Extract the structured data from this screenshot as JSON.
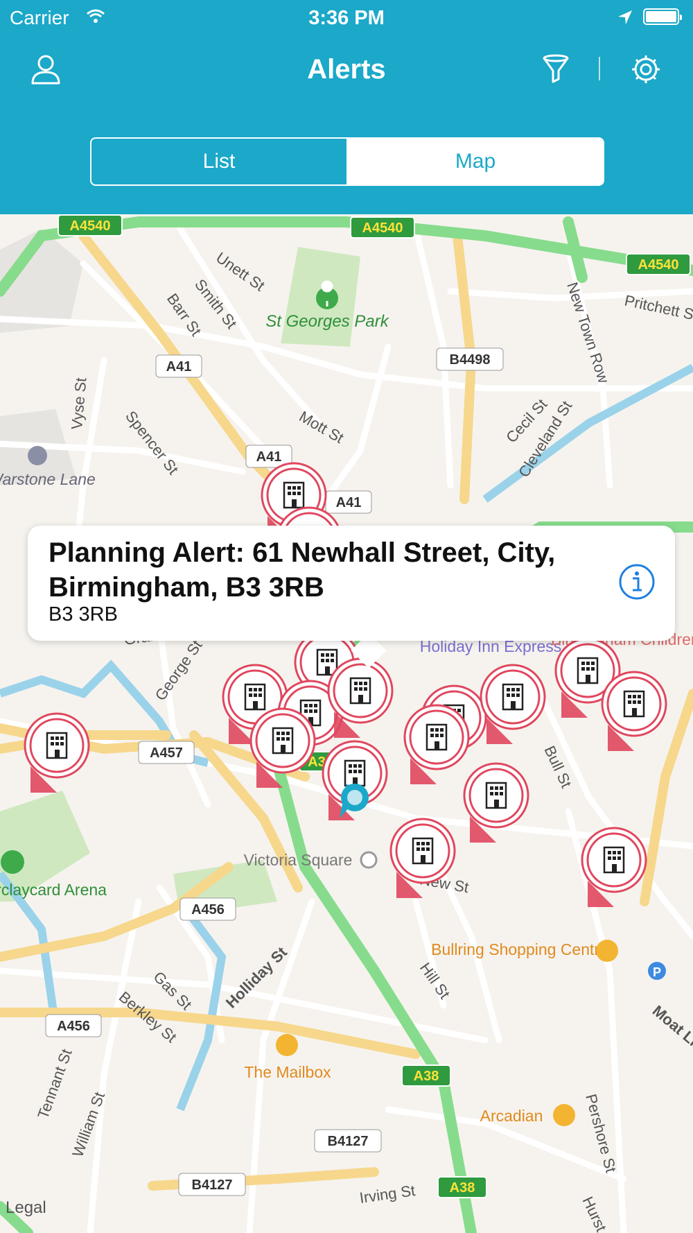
{
  "status_bar": {
    "carrier": "Carrier",
    "time": "3:36 PM"
  },
  "nav": {
    "title": "Alerts"
  },
  "segments": {
    "list_label": "List",
    "map_label": "Map",
    "selected": "Map"
  },
  "map": {
    "road_labels": [
      "A4540",
      "A4540",
      "A4540",
      "A41",
      "A41",
      "A41",
      "B4498",
      "A457",
      "A456",
      "A456",
      "A38",
      "A38",
      "B4127",
      "B4127",
      "A3"
    ],
    "street_labels": [
      "Unett St",
      "Smith St",
      "Barr St",
      "Pritchett St",
      "New Town Row",
      "Vyse St",
      "Spencer St",
      "Mott St",
      "Cecil St",
      "Cleveland St",
      "Graham St",
      "George St",
      "Bull St",
      "Holliday St",
      "Gas St",
      "Berkley St",
      "Hill St",
      "Tennant St",
      "William St",
      "Irving St",
      "Pershore St",
      "Hurst St",
      "Moat Ln",
      "New St"
    ],
    "place_labels": {
      "park": "St Georges Park",
      "warstone": "Warstone Lane",
      "holiday_inn": "Holiday Inn Express",
      "hospital": "Birmingham Children's Hospital",
      "victoria": "Victoria Square",
      "barclaycard": "Barclaycard Arena",
      "bullring": "Bullring Shopping Centre",
      "mailbox": "The Mailbox",
      "arcadian": "Arcadian"
    },
    "legal": "Legal",
    "pin_icon": "building-icon",
    "pin_color": "#e0475e",
    "user_location_color": "#1ba8c9"
  },
  "callout": {
    "title": "Planning Alert: 61 Newhall Street, City, Birmingham, B3 3RB",
    "subtitle": "B3 3RB"
  },
  "colors": {
    "header": "#1ba8c9",
    "motorway": "#86dc8c",
    "a_road": "#f6d78c",
    "water": "#9ad2ea",
    "info": "#1f7fe0"
  }
}
